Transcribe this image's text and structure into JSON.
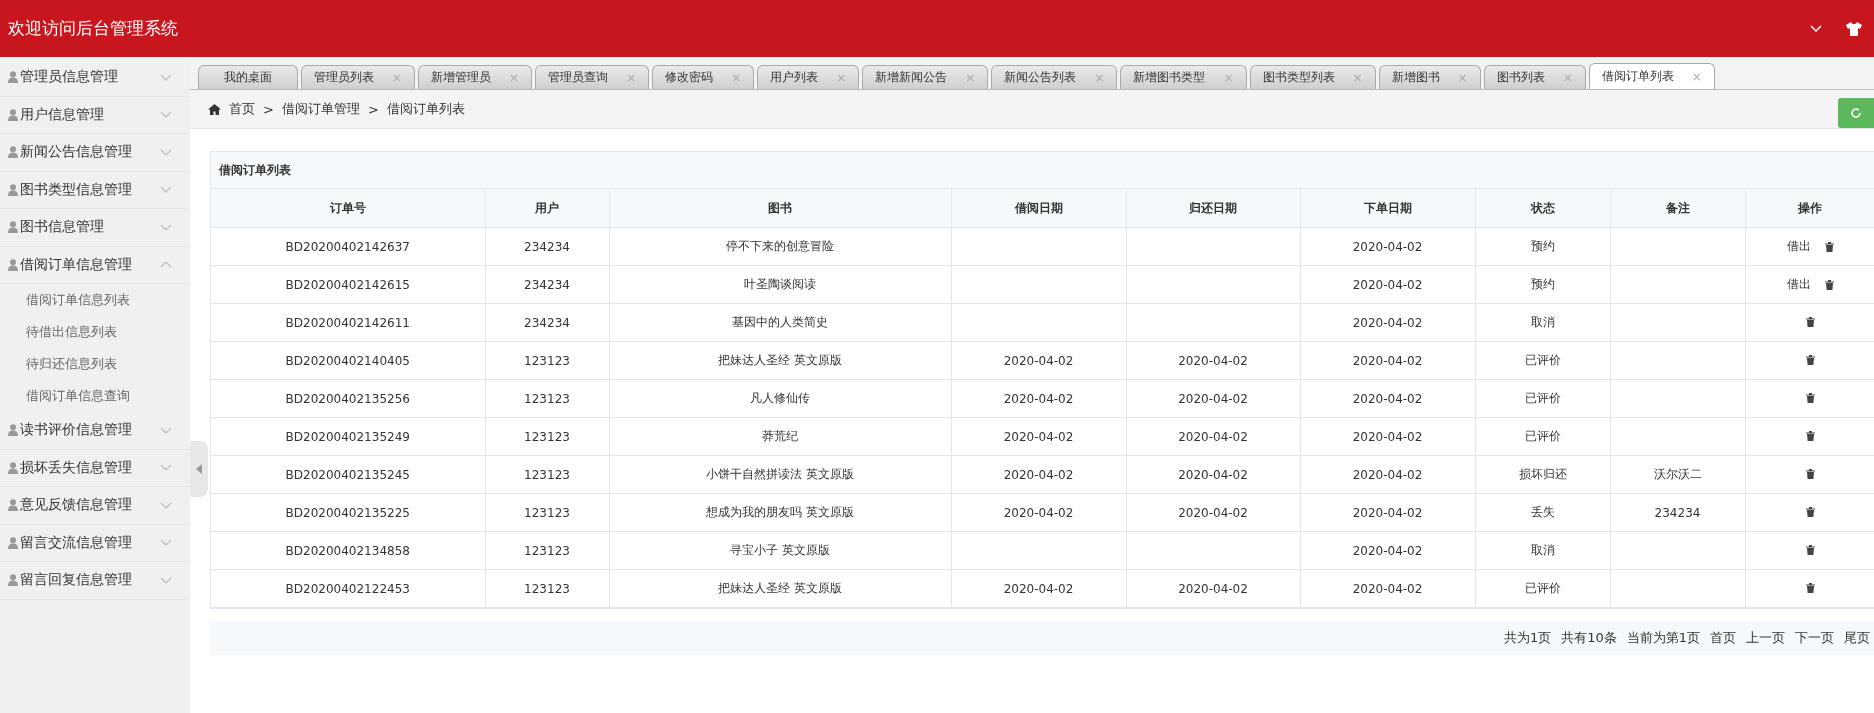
{
  "header": {
    "title": "欢迎访问后台管理系统"
  },
  "sidebar": {
    "items": [
      {
        "label": "管理员信息管理",
        "expanded": false
      },
      {
        "label": "用户信息管理",
        "expanded": false
      },
      {
        "label": "新闻公告信息管理",
        "expanded": false
      },
      {
        "label": "图书类型信息管理",
        "expanded": false
      },
      {
        "label": "图书信息管理",
        "expanded": false
      },
      {
        "label": "借阅订单信息管理",
        "expanded": true,
        "children": [
          {
            "label": "借阅订单信息列表"
          },
          {
            "label": "待借出信息列表"
          },
          {
            "label": "待归还信息列表"
          },
          {
            "label": "借阅订单信息查询"
          }
        ]
      },
      {
        "label": "读书评价信息管理",
        "expanded": false
      },
      {
        "label": "损坏丢失信息管理",
        "expanded": false
      },
      {
        "label": "意见反馈信息管理",
        "expanded": false
      },
      {
        "label": "留言交流信息管理",
        "expanded": false
      },
      {
        "label": "留言回复信息管理",
        "expanded": false
      }
    ]
  },
  "tabs": [
    {
      "label": "我的桌面",
      "selected": false
    },
    {
      "label": "管理员列表",
      "selected": false,
      "close": "×"
    },
    {
      "label": "新增管理员",
      "selected": false,
      "close": "×"
    },
    {
      "label": "管理员查询",
      "selected": false,
      "close": "×"
    },
    {
      "label": "修改密码",
      "selected": false,
      "close": "×"
    },
    {
      "label": "用户列表",
      "selected": false,
      "close": "×"
    },
    {
      "label": "新增新闻公告",
      "selected": false,
      "close": "×"
    },
    {
      "label": "新闻公告列表",
      "selected": false,
      "close": "×"
    },
    {
      "label": "新增图书类型",
      "selected": false,
      "close": "×"
    },
    {
      "label": "图书类型列表",
      "selected": false,
      "close": "×"
    },
    {
      "label": "新增图书",
      "selected": false,
      "close": "×"
    },
    {
      "label": "图书列表",
      "selected": false,
      "close": "×"
    },
    {
      "label": "借阅订单列表",
      "selected": true,
      "close": "×"
    }
  ],
  "breadcrumb": [
    "首页",
    "借阅订单管理",
    "借阅订单列表"
  ],
  "breadcrumb_separator": ">",
  "table": {
    "title": "借阅订单列表",
    "columns": [
      "订单号",
      "用户",
      "图书",
      "借阅日期",
      "归还日期",
      "下单日期",
      "状态",
      "备注",
      "操作"
    ],
    "rows": [
      {
        "cells": [
          "BD20200402142637",
          "234234",
          "停不下来的创意冒险",
          "",
          "",
          "2020-04-02",
          "预约",
          ""
        ],
        "action": "借出"
      },
      {
        "cells": [
          "BD20200402142615",
          "234234",
          "叶圣陶谈阅读",
          "",
          "",
          "2020-04-02",
          "预约",
          ""
        ],
        "action": "借出"
      },
      {
        "cells": [
          "BD20200402142611",
          "234234",
          "基因中的人类简史",
          "",
          "",
          "2020-04-02",
          "取消",
          ""
        ]
      },
      {
        "cells": [
          "BD20200402140405",
          "123123",
          "把妹达人圣经 英文原版",
          "2020-04-02",
          "2020-04-02",
          "2020-04-02",
          "已评价",
          ""
        ]
      },
      {
        "cells": [
          "BD20200402135256",
          "123123",
          "凡人修仙传",
          "2020-04-02",
          "2020-04-02",
          "2020-04-02",
          "已评价",
          ""
        ]
      },
      {
        "cells": [
          "BD20200402135249",
          "123123",
          "莽荒纪",
          "2020-04-02",
          "2020-04-02",
          "2020-04-02",
          "已评价",
          ""
        ]
      },
      {
        "cells": [
          "BD20200402135245",
          "123123",
          "小饼干自然拼读法 英文原版",
          "2020-04-02",
          "2020-04-02",
          "2020-04-02",
          "损坏归还",
          "沃尔沃二"
        ]
      },
      {
        "cells": [
          "BD20200402135225",
          "123123",
          "想成为我的朋友吗 英文原版",
          "2020-04-02",
          "2020-04-02",
          "2020-04-02",
          "丢失",
          "234234"
        ]
      },
      {
        "cells": [
          "BD20200402134858",
          "123123",
          "寻宝小子 英文原版",
          "",
          "",
          "2020-04-02",
          "取消",
          ""
        ]
      },
      {
        "cells": [
          "BD20200402122453",
          "123123",
          "把妹达人圣经 英文原版",
          "2020-04-02",
          "2020-04-02",
          "2020-04-02",
          "已评价",
          ""
        ]
      }
    ]
  },
  "pagination": [
    "共为1页",
    "共有10条",
    "当前为第1页",
    "首页",
    "上一页",
    "下一页",
    "尾页"
  ]
}
